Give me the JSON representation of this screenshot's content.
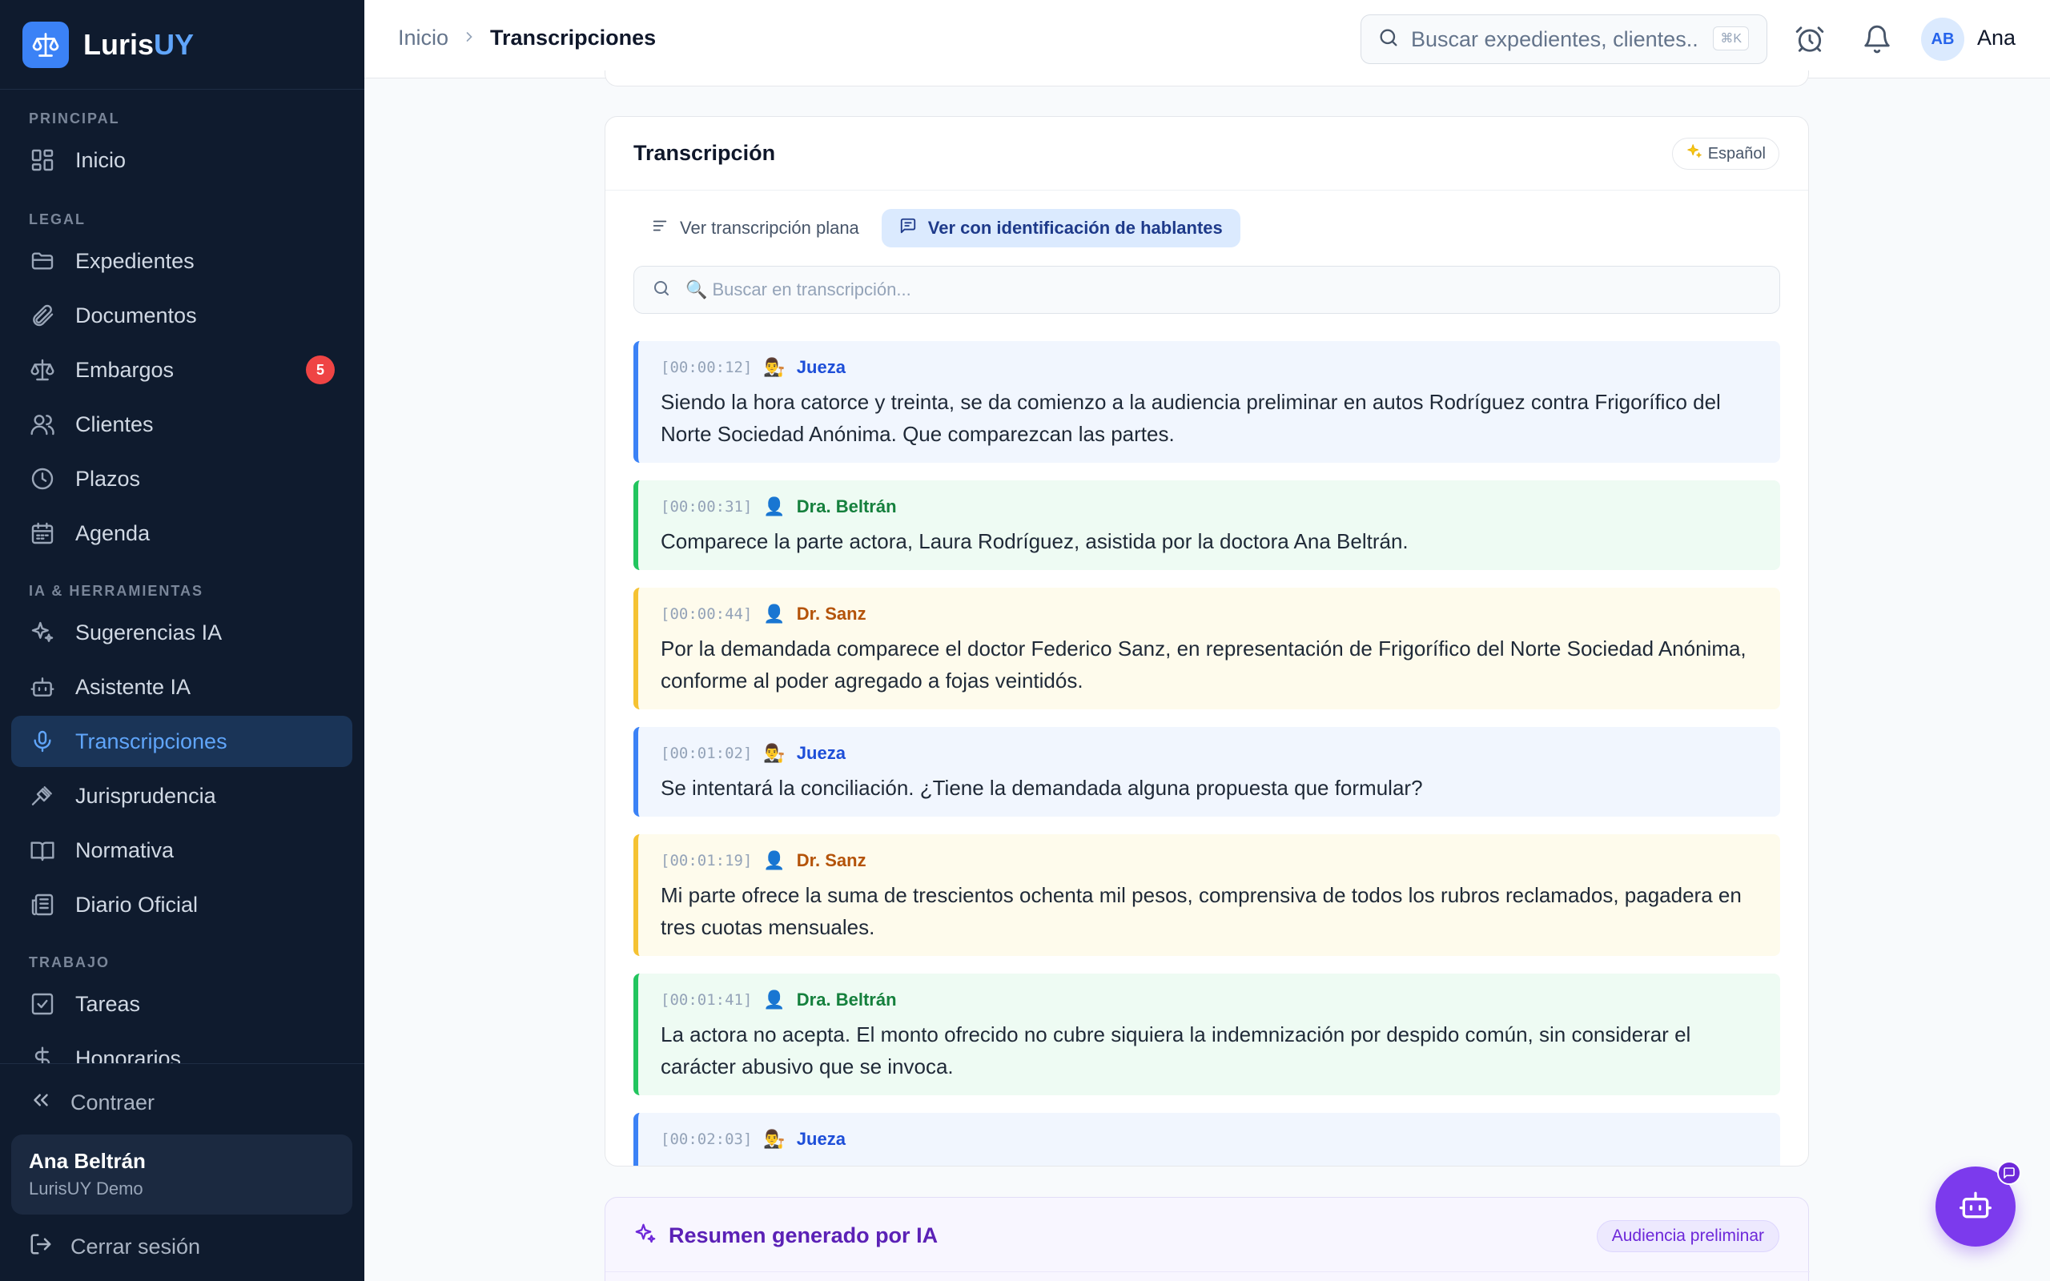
{
  "brand": {
    "name_main": "Luris",
    "name_accent": "UY"
  },
  "sidebar": {
    "sections": {
      "principal": "PRINCIPAL",
      "legal": "LEGAL",
      "ia": "IA & HERRAMIENTAS",
      "trabajo": "TRABAJO"
    },
    "items": {
      "inicio": "Inicio",
      "expedientes": "Expedientes",
      "documentos": "Documentos",
      "embargos": "Embargos",
      "embargos_badge": "5",
      "clientes": "Clientes",
      "plazos": "Plazos",
      "agenda": "Agenda",
      "sugerencias": "Sugerencias IA",
      "asistente": "Asistente IA",
      "transcripciones": "Transcripciones",
      "jurisprudencia": "Jurisprudencia",
      "normativa": "Normativa",
      "diario": "Diario Oficial",
      "tareas": "Tareas",
      "honorarios": "Honorarios"
    },
    "collapse_label": "Contraer",
    "user": {
      "name": "Ana Beltrán",
      "org": "LurisUY Demo"
    },
    "logout_label": "Cerrar sesión",
    "active_color": "#60a5fa"
  },
  "topbar": {
    "breadcrumb": {
      "root": "Inicio",
      "current": "Transcripciones"
    },
    "search_placeholder": "Buscar expedientes, clientes...",
    "search_shortcut": "⌘K",
    "user_initials": "AB",
    "user_name": "Ana"
  },
  "transcript": {
    "title": "Transcripción",
    "language": "Español",
    "tabs": {
      "plain": "Ver transcripción plana",
      "speakers": "Ver con identificación de hablantes"
    },
    "search_placeholder": "🔍 Buscar en transcripción...",
    "segments": [
      {
        "time": "[00:00:12]",
        "icon": "👨‍⚖️",
        "speaker": "Jueza",
        "text": "Siendo la hora catorce y treinta, se da comienzo a la audiencia preliminar en autos Rodríguez contra Frigorífico del Norte Sociedad Anónima. Que comparezcan las partes."
      },
      {
        "time": "[00:00:31]",
        "icon": "👤",
        "speaker": "Dra. Beltrán",
        "text": "Comparece la parte actora, Laura Rodríguez, asistida por la doctora Ana Beltrán."
      },
      {
        "time": "[00:00:44]",
        "icon": "👤",
        "speaker": "Dr. Sanz",
        "text": "Por la demandada comparece el doctor Federico Sanz, en representación de Frigorífico del Norte Sociedad Anónima, conforme al poder agregado a fojas veintidós."
      },
      {
        "time": "[00:01:02]",
        "icon": "👨‍⚖️",
        "speaker": "Jueza",
        "text": "Se intentará la conciliación. ¿Tiene la demandada alguna propuesta que formular?"
      },
      {
        "time": "[00:01:19]",
        "icon": "👤",
        "speaker": "Dr. Sanz",
        "text": "Mi parte ofrece la suma de trescientos ochenta mil pesos, comprensiva de todos los rubros reclamados, pagadera en tres cuotas mensuales."
      },
      {
        "time": "[00:01:41]",
        "icon": "👤",
        "speaker": "Dra. Beltrán",
        "text": "La actora no acepta. El monto ofrecido no cubre siquiera la indemnización por despido común, sin considerar el carácter abusivo que se invoca."
      },
      {
        "time": "[00:02:03]",
        "icon": "👨‍⚖️",
        "speaker": "Jueza",
        "text": ""
      }
    ]
  },
  "summary": {
    "title": "Resumen generado por IA",
    "tag": "Audiencia preliminar"
  }
}
